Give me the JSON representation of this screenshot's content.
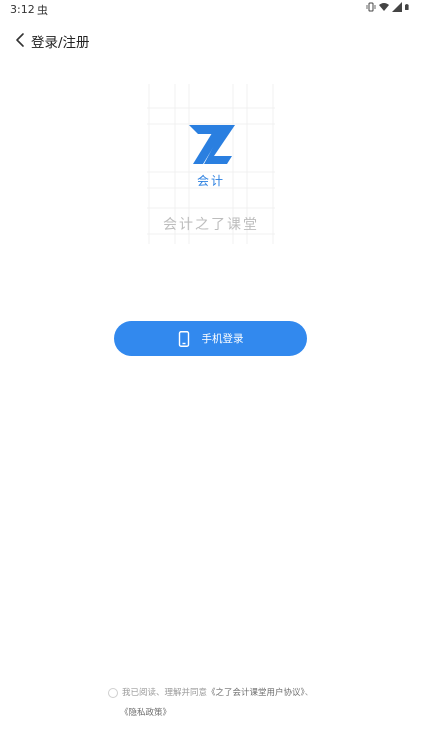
{
  "status_bar": {
    "time": "3:12",
    "notification_glyph": "虫"
  },
  "nav": {
    "title": "登录/注册"
  },
  "logo": {
    "sub_text": "会计",
    "app_name": "会计之了课堂",
    "brand_color": "#2A7FE0"
  },
  "login": {
    "phone_button_label": "手机登录",
    "button_color": "#3289EE"
  },
  "agreement": {
    "prefix": "我已阅读、理解并同意",
    "user_agreement_link": "《之了会计课堂用户协议》",
    "separator": "、",
    "privacy_policy_link": "《隐私政策》"
  }
}
